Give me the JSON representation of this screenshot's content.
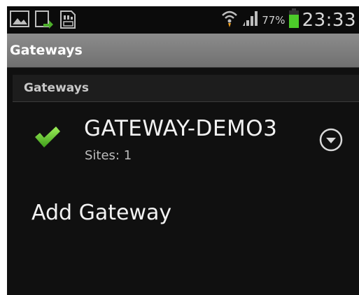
{
  "statusbar": {
    "battery_percent": "77%",
    "time": "23:33",
    "icons": [
      "gallery-icon",
      "sync-icon",
      "sd-card-icon",
      "wifi-icon",
      "signal-icon",
      "battery-icon"
    ]
  },
  "actionbar": {
    "title": "Gateways"
  },
  "section": {
    "header": "Gateways"
  },
  "gateways": [
    {
      "name": "GATEWAY-DEMO3",
      "subtitle": "Sites: 1",
      "status_icon": "checkmark-icon",
      "status_color": "#6fcf2a"
    }
  ],
  "add_gateway_label": "Add Gateway"
}
